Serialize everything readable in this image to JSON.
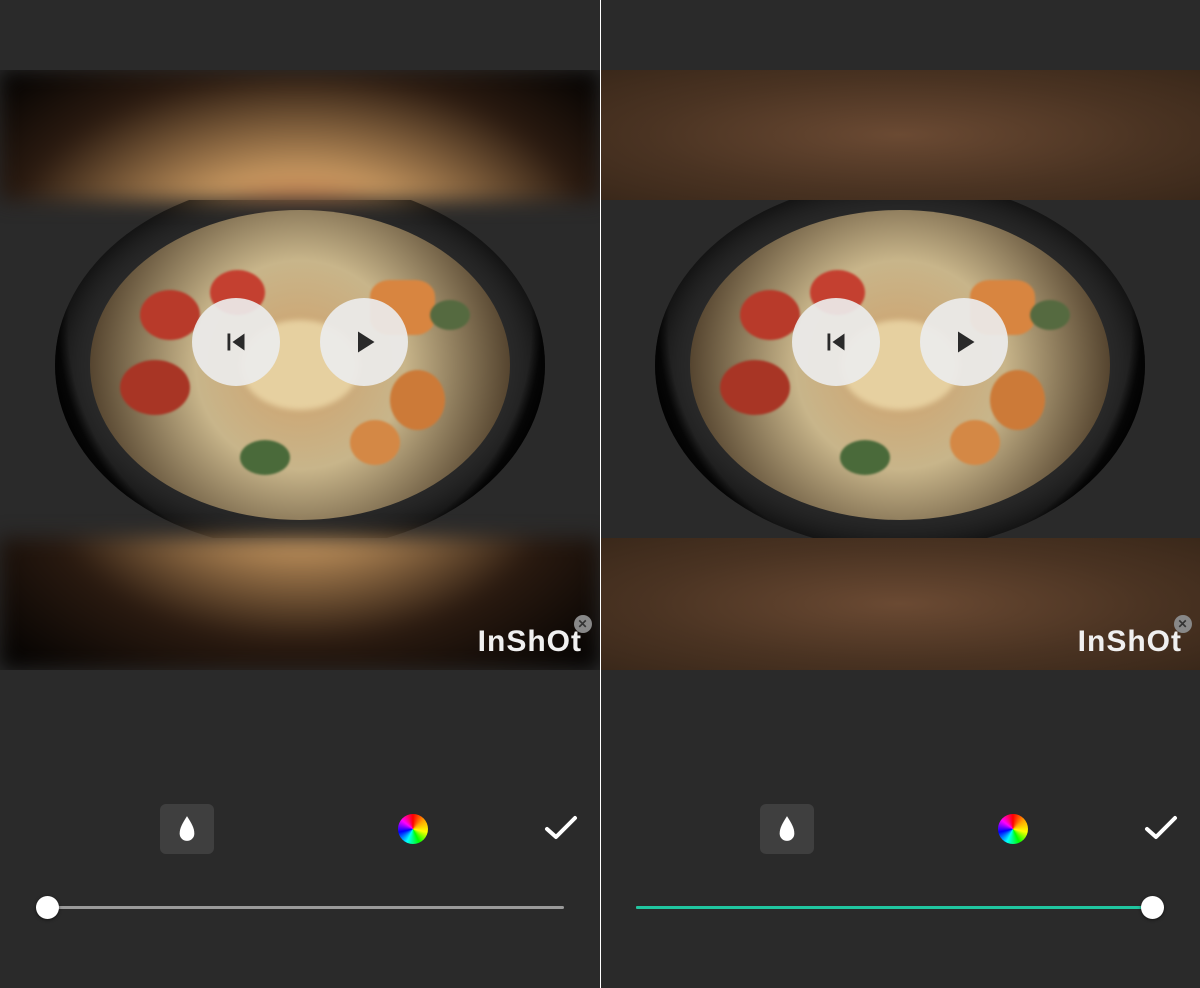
{
  "watermark": {
    "text": "InShOt"
  },
  "leftPane": {
    "fill_mode": "blur",
    "slider_value": 0,
    "slider_max": 100
  },
  "rightPane": {
    "fill_mode": "gradient",
    "slider_value": 98,
    "slider_max": 100
  },
  "icons": {
    "prev": "skip-previous",
    "play": "play",
    "blur_tool": "water-drop",
    "color_tool": "color-wheel",
    "confirm": "checkmark",
    "close": "x"
  }
}
